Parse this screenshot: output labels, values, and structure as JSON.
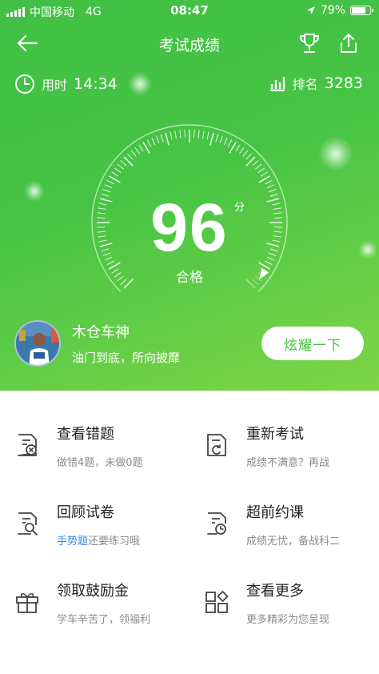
{
  "status": {
    "carrier": "中国移动",
    "network": "4G",
    "time": "08:47",
    "battery": "79%",
    "battery_level": 0.79
  },
  "nav": {
    "title": "考试成绩"
  },
  "stats": {
    "time_label": "用时",
    "time_value": "14:34",
    "rank_label": "排名",
    "rank_value": "3283"
  },
  "result": {
    "score": "96",
    "unit": "分",
    "verdict": "合格",
    "score_fraction": 0.96
  },
  "user": {
    "name": "木仓车神",
    "slogan": "油门到底，所向披靡",
    "share_button": "炫耀一下"
  },
  "actions": [
    {
      "title": "查看错题",
      "subtitle": "做错4题，未做0题",
      "icon": "wrong-questions-icon"
    },
    {
      "title": "重新考试",
      "subtitle": "成绩不满意？再战",
      "icon": "retake-exam-icon"
    },
    {
      "title": "回顾试卷",
      "subtitle_highlight": "手势题",
      "subtitle": "还要练习哦",
      "icon": "review-paper-icon"
    },
    {
      "title": "超前约课",
      "subtitle": "成绩无忧，备战科二",
      "icon": "book-class-icon"
    },
    {
      "title": "领取鼓励金",
      "subtitle": "学车辛苦了，领福利",
      "icon": "gift-icon"
    },
    {
      "title": "查看更多",
      "subtitle": "更多精彩为您呈现",
      "icon": "more-grid-icon"
    }
  ],
  "colors": {
    "accent": "#45bf3e",
    "hero_start": "#41c045",
    "hero_end": "#7fd646",
    "highlight": "#2f8be8"
  }
}
